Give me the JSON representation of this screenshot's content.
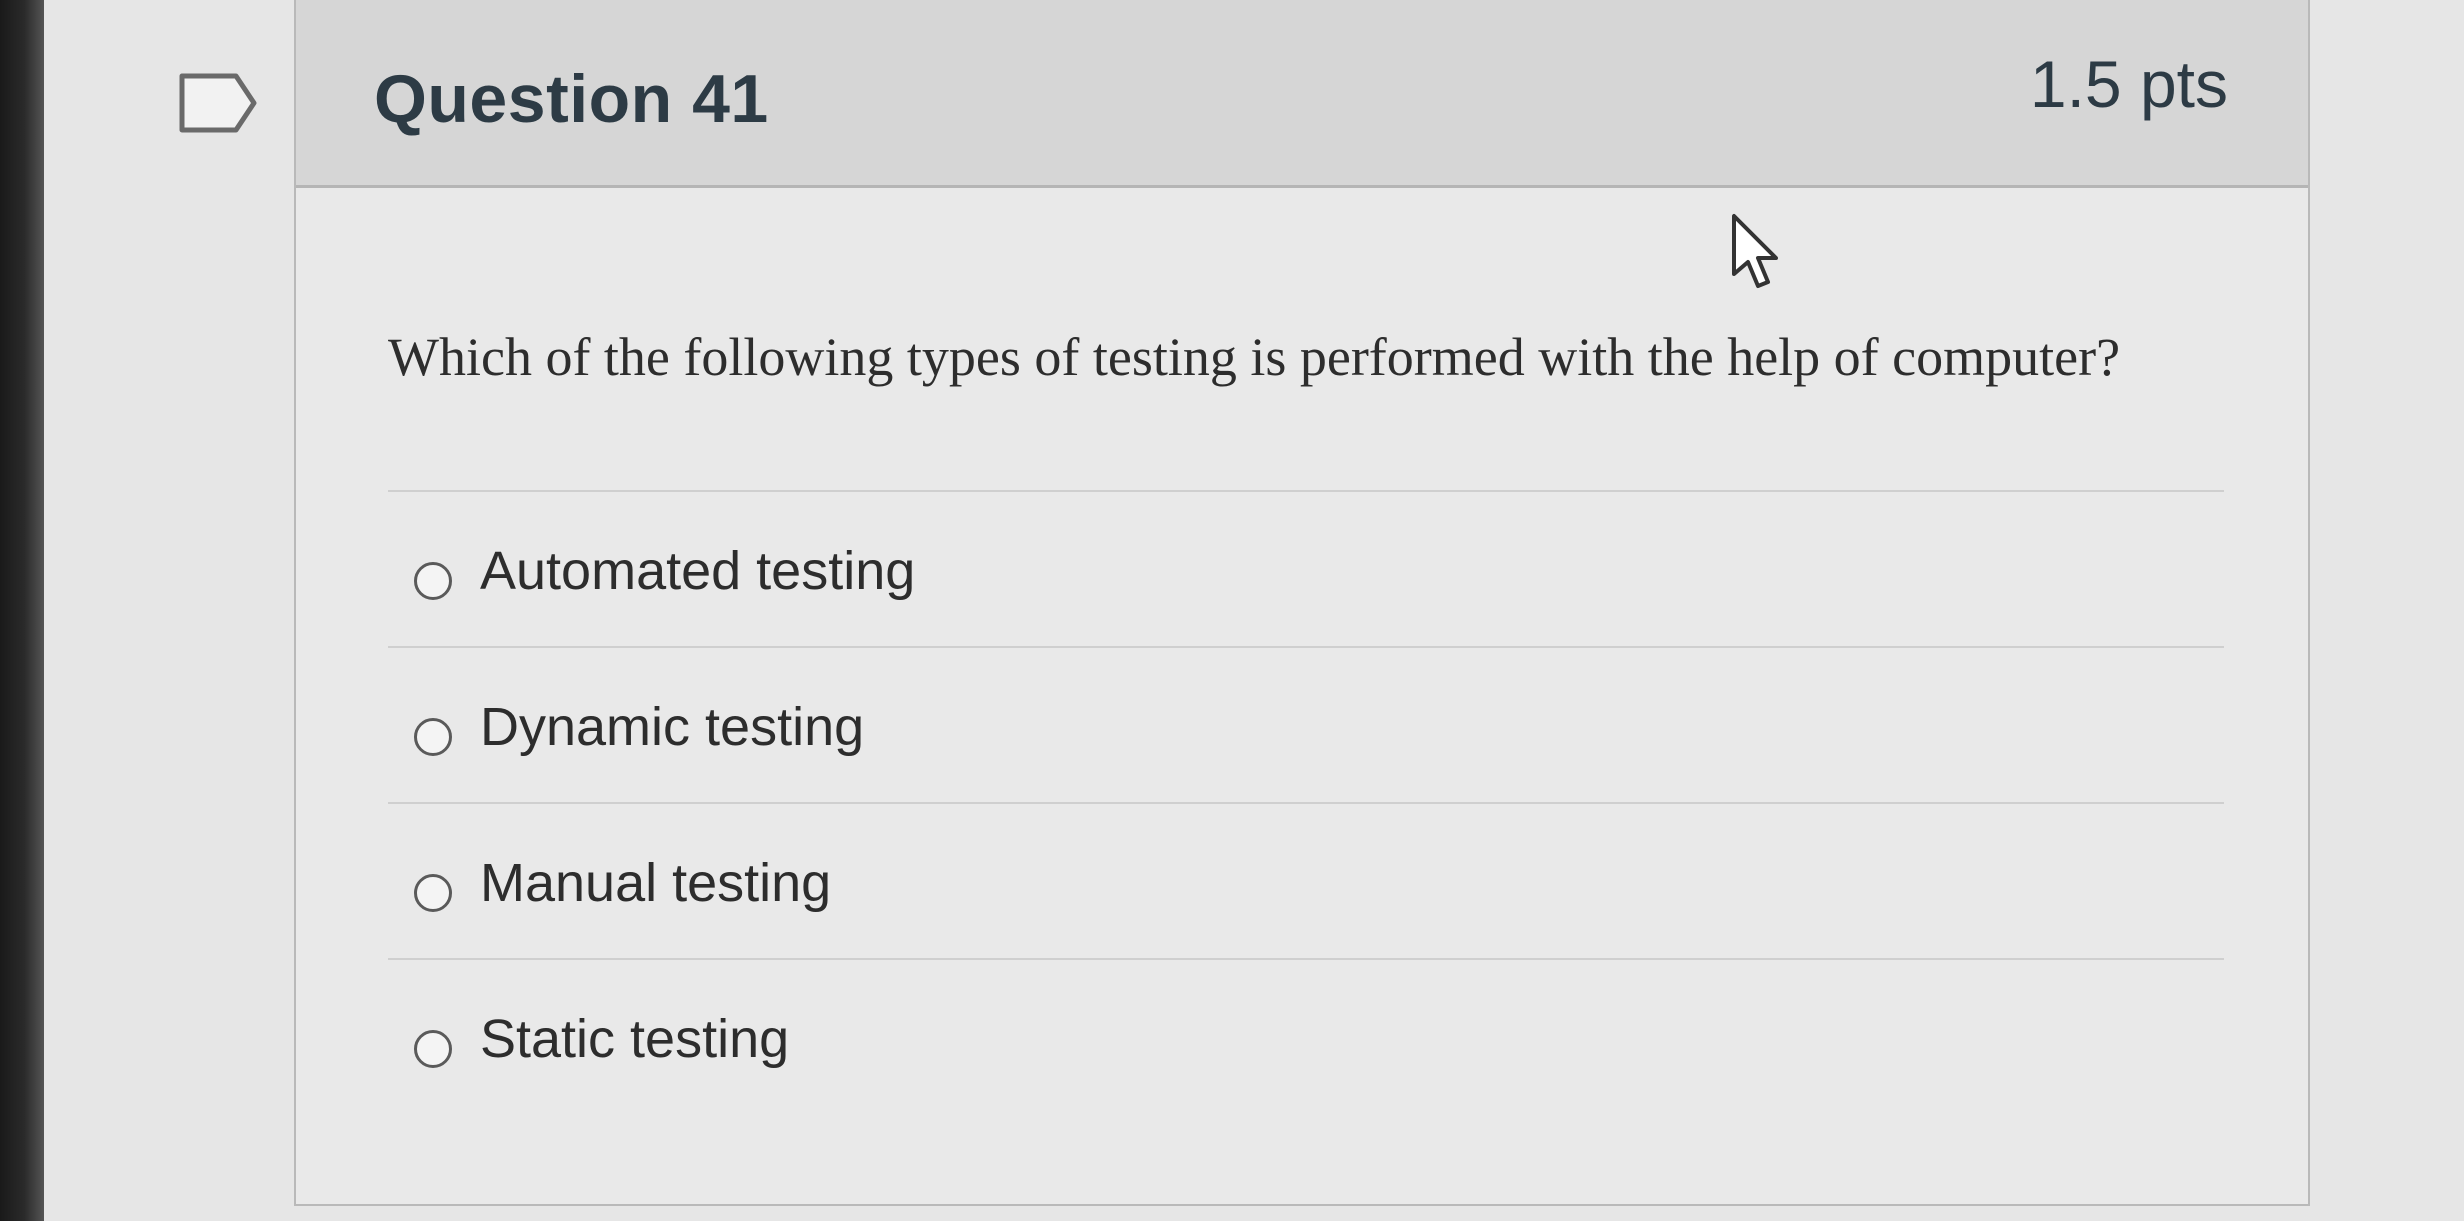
{
  "question": {
    "title": "Question 41",
    "points": "1.5 pts",
    "prompt": "Which of the following types of testing is performed with the help of computer?",
    "flag_icon": "flag-outline-icon",
    "answers": [
      {
        "label": "Automated testing",
        "selected": false
      },
      {
        "label": "Dynamic testing",
        "selected": false
      },
      {
        "label": "Manual testing",
        "selected": false
      },
      {
        "label": "Static testing",
        "selected": false
      }
    ]
  },
  "cursor": {
    "icon": "mouse-pointer-icon"
  },
  "colors": {
    "header_bg": "#d6d6d6",
    "card_bg": "#e9e9e9",
    "text": "#2d3b45"
  }
}
